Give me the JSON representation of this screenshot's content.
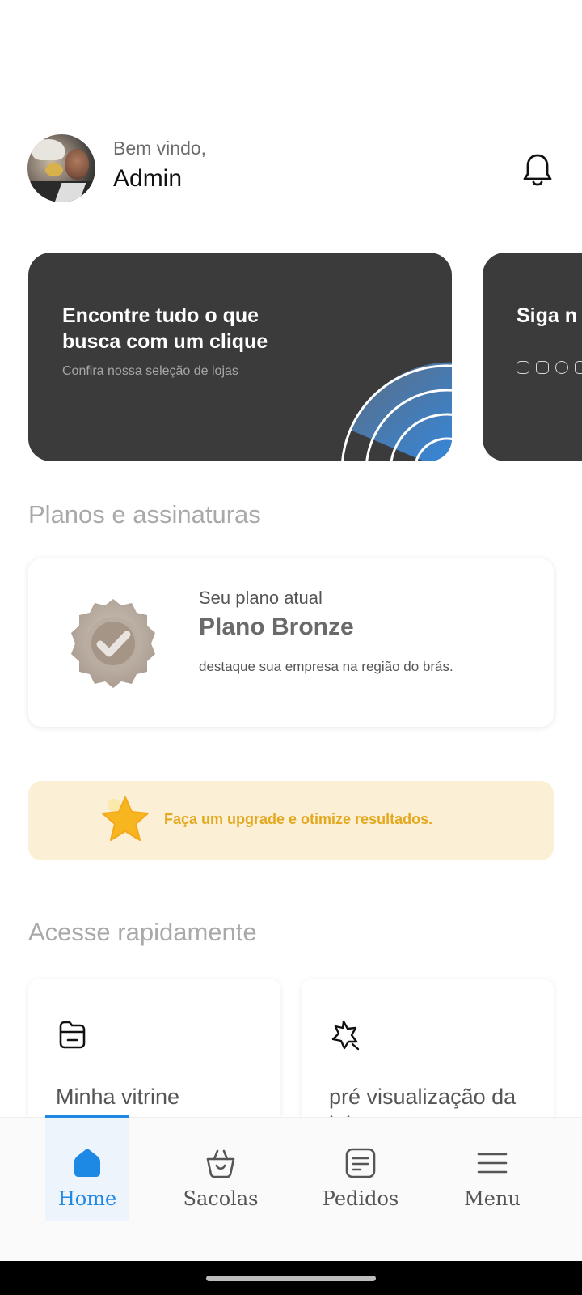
{
  "header": {
    "welcome": "Bem vindo,",
    "username": "Admin",
    "icons": {
      "avatar": "profile-photo",
      "notifications": "bell-icon"
    }
  },
  "banners": [
    {
      "title": "Encontre tudo o que busca com um clique",
      "subtitle": "Confira nossa seleção de lojas",
      "icon": "radar-graphic"
    },
    {
      "title": "Siga n para fi",
      "social_icons": [
        "instagram-icon",
        "facebook-icon",
        "google-icon",
        "youtube-icon"
      ]
    }
  ],
  "plans": {
    "section_title": "Planos e assinaturas",
    "label": "Seu plano atual",
    "name": "Plano Bronze",
    "description": "destaque sua empresa na região do brás.",
    "badge_icon": "bronze-badge-icon"
  },
  "upgrade": {
    "text": "Faça um upgrade e otimize resultados.",
    "icon": "star-icon",
    "text_color": "#e3a81f",
    "bg_color": "#fbf0d5"
  },
  "quick_access": {
    "section_title": "Acesse rapidamente",
    "items": [
      {
        "label": "Minha vitrine",
        "icon": "storefront-icon"
      },
      {
        "label": "pré visualização da loja",
        "icon": "preview-star-icon"
      }
    ]
  },
  "bottom_nav": {
    "active_color": "#1e88e5",
    "items": [
      {
        "label": "Home",
        "icon": "home-icon",
        "active": true
      },
      {
        "label": "Sacolas",
        "icon": "basket-icon",
        "active": false
      },
      {
        "label": "Pedidos",
        "icon": "orders-icon",
        "active": false
      },
      {
        "label": "Menu",
        "icon": "menu-icon",
        "active": false
      }
    ]
  }
}
